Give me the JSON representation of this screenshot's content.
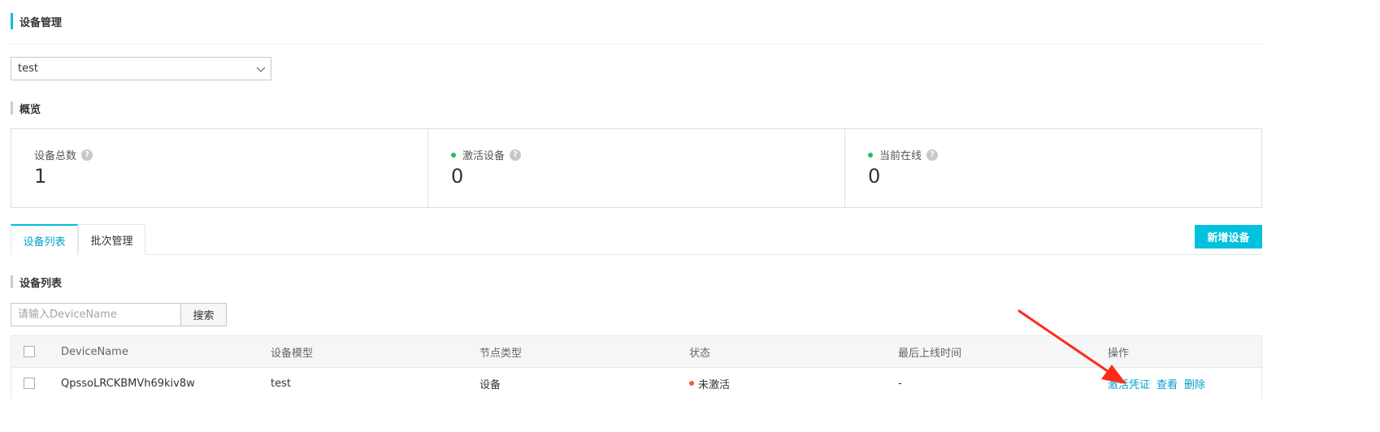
{
  "page": {
    "title": "设备管理"
  },
  "product_select": {
    "value": "test"
  },
  "overview": {
    "title": "概览",
    "stats": [
      {
        "label": "设备总数",
        "value": "1",
        "dot": false
      },
      {
        "label": "激活设备",
        "value": "0",
        "dot": true
      },
      {
        "label": "当前在线",
        "value": "0",
        "dot": true
      }
    ],
    "help_glyph": "?"
  },
  "tabs": [
    {
      "label": "设备列表"
    },
    {
      "label": "批次管理"
    }
  ],
  "add_device_label": "新增设备",
  "device_list": {
    "title": "设备列表",
    "search_placeholder": "请输入DeviceName",
    "search_button": "搜索",
    "columns": [
      "DeviceName",
      "设备模型",
      "节点类型",
      "状态",
      "最后上线时间",
      "操作"
    ],
    "rows": [
      {
        "device_name": "QpssoLRCKBMVh69kiv8w",
        "model": "test",
        "node_type": "设备",
        "status": "未激活",
        "last_online": "-",
        "actions": [
          "激活凭证",
          "查看",
          "删除"
        ]
      }
    ]
  },
  "colors": {
    "accent": "#00c1de",
    "link": "#00a2c8",
    "status_inactive": "#f45b38",
    "status_active": "#1ac15e",
    "annotation_arrow": "#ff2a1a"
  },
  "icons": {
    "select_chevron": "chevron-down-icon",
    "help": "help-icon",
    "annotation": "red-arrow-annotation"
  }
}
